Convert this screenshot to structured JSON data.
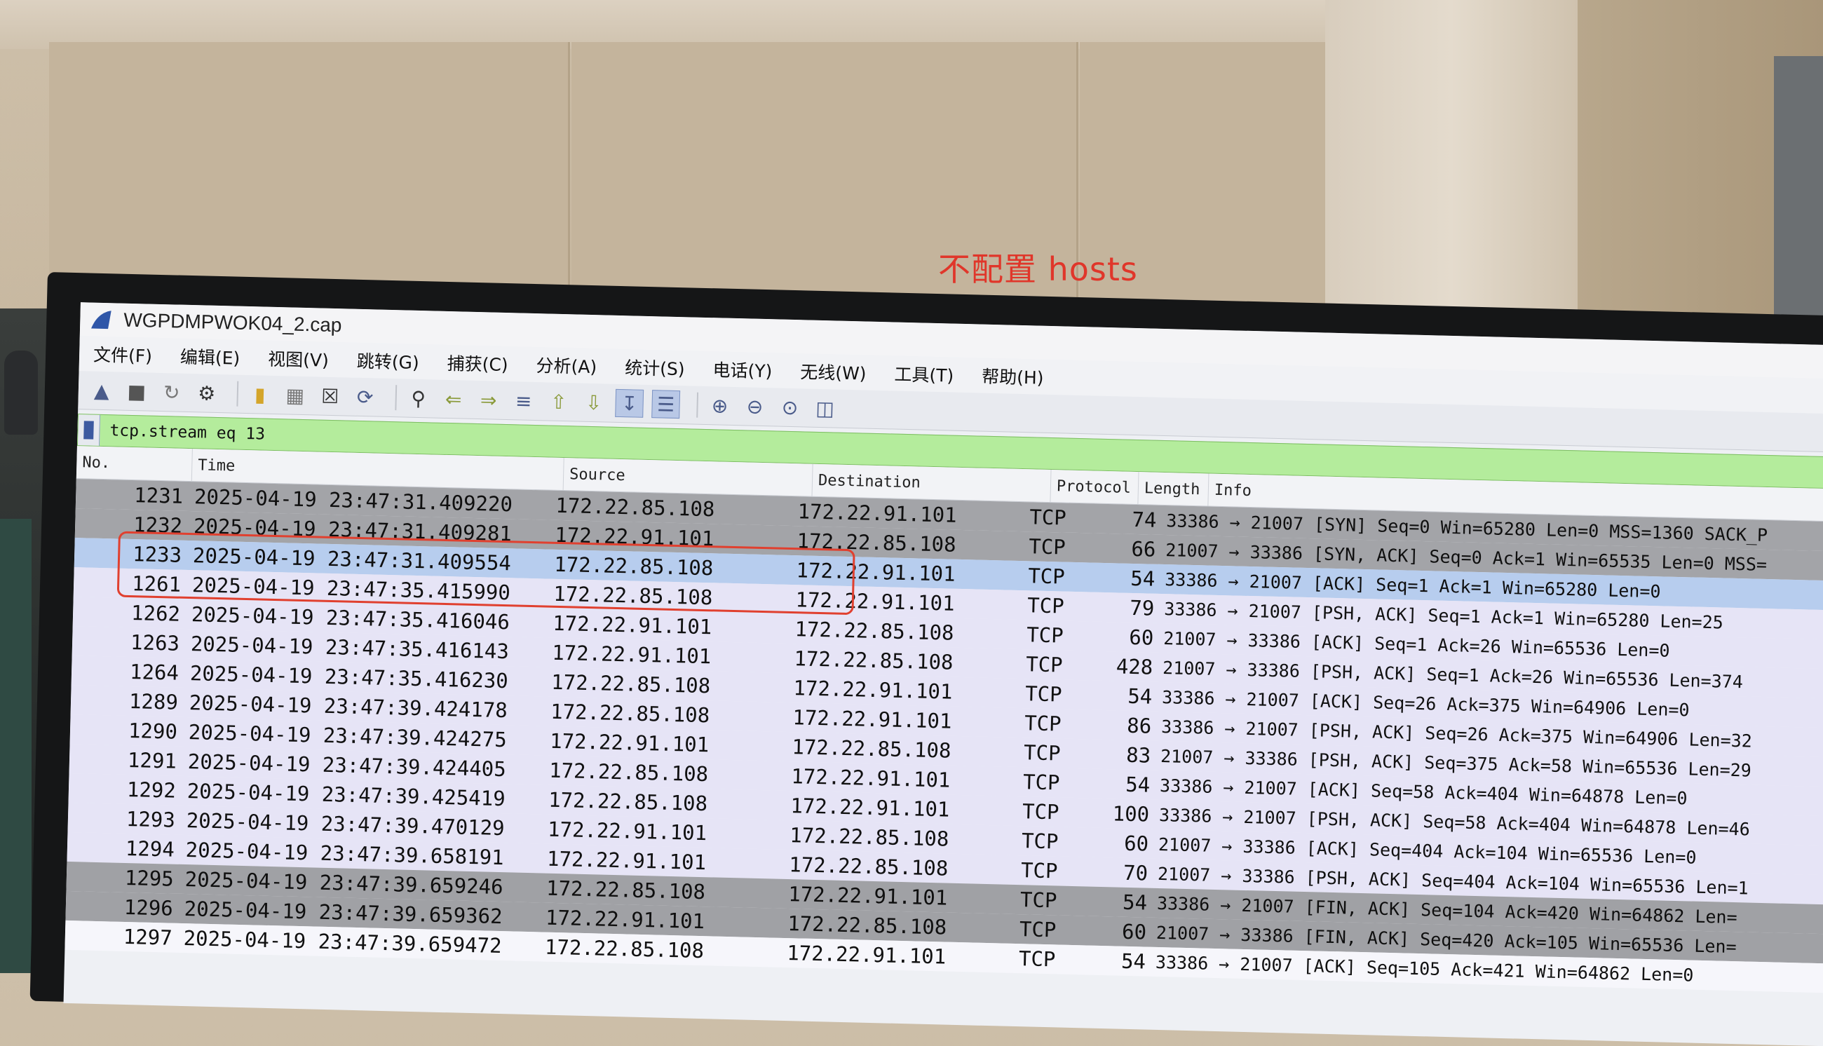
{
  "annotation_label": "不配置 hosts",
  "window": {
    "title": "WGPDMPWOK04_2.cap"
  },
  "menu": [
    "文件(F)",
    "编辑(E)",
    "视图(V)",
    "跳转(G)",
    "捕获(C)",
    "分析(A)",
    "统计(S)",
    "电话(Y)",
    "无线(W)",
    "工具(T)",
    "帮助(H)"
  ],
  "toolbar_icons": [
    "shark-fin-icon",
    "stop-icon",
    "restart-icon",
    "options-icon",
    "open-file-icon",
    "save-icon",
    "close-file-icon",
    "reload-icon",
    "find-icon",
    "back-arrow-icon",
    "forward-arrow-icon",
    "go-to-packet-icon",
    "first-packet-icon",
    "last-packet-icon",
    "autoscroll-icon",
    "colorize-icon",
    "zoom-in-icon",
    "zoom-out-icon",
    "normal-size-icon",
    "resize-columns-icon"
  ],
  "filter": {
    "value": "tcp.stream eq 13"
  },
  "columns": [
    "No.",
    "Time",
    "Source",
    "Destination",
    "Protocol",
    "Length",
    "Info"
  ],
  "packets": [
    {
      "no": "1231",
      "time": "2025-04-19 23:47:31.409220",
      "src": "172.22.85.108",
      "dst": "172.22.91.101",
      "proto": "TCP",
      "len": "74",
      "info": "33386 → 21007 [SYN] Seq=0 Win=65280 Len=0 MSS=1360 SACK_P",
      "style": "syn"
    },
    {
      "no": "1232",
      "time": "2025-04-19 23:47:31.409281",
      "src": "172.22.91.101",
      "dst": "172.22.85.108",
      "proto": "TCP",
      "len": "66",
      "info": "21007 → 33386 [SYN, ACK] Seq=0 Ack=1 Win=65535 Len=0 MSS=",
      "style": "syn"
    },
    {
      "no": "1233",
      "time": "2025-04-19 23:47:31.409554",
      "src": "172.22.85.108",
      "dst": "172.22.91.101",
      "proto": "TCP",
      "len": "54",
      "info": "33386 → 21007 [ACK] Seq=1 Ack=1 Win=65280 Len=0",
      "style": "sel"
    },
    {
      "no": "1261",
      "time": "2025-04-19 23:47:35.415990",
      "src": "172.22.85.108",
      "dst": "172.22.91.101",
      "proto": "TCP",
      "len": "79",
      "info": "33386 → 21007 [PSH, ACK] Seq=1 Ack=1 Win=65280 Len=25",
      "style": "norm"
    },
    {
      "no": "1262",
      "time": "2025-04-19 23:47:35.416046",
      "src": "172.22.91.101",
      "dst": "172.22.85.108",
      "proto": "TCP",
      "len": "60",
      "info": "21007 → 33386 [ACK] Seq=1 Ack=26 Win=65536 Len=0",
      "style": "norm"
    },
    {
      "no": "1263",
      "time": "2025-04-19 23:47:35.416143",
      "src": "172.22.91.101",
      "dst": "172.22.85.108",
      "proto": "TCP",
      "len": "428",
      "info": "21007 → 33386 [PSH, ACK] Seq=1 Ack=26 Win=65536 Len=374",
      "style": "norm"
    },
    {
      "no": "1264",
      "time": "2025-04-19 23:47:35.416230",
      "src": "172.22.85.108",
      "dst": "172.22.91.101",
      "proto": "TCP",
      "len": "54",
      "info": "33386 → 21007 [ACK] Seq=26 Ack=375 Win=64906 Len=0",
      "style": "norm"
    },
    {
      "no": "1289",
      "time": "2025-04-19 23:47:39.424178",
      "src": "172.22.85.108",
      "dst": "172.22.91.101",
      "proto": "TCP",
      "len": "86",
      "info": "33386 → 21007 [PSH, ACK] Seq=26 Ack=375 Win=64906 Len=32",
      "style": "norm"
    },
    {
      "no": "1290",
      "time": "2025-04-19 23:47:39.424275",
      "src": "172.22.91.101",
      "dst": "172.22.85.108",
      "proto": "TCP",
      "len": "83",
      "info": "21007 → 33386 [PSH, ACK] Seq=375 Ack=58 Win=65536 Len=29",
      "style": "norm"
    },
    {
      "no": "1291",
      "time": "2025-04-19 23:47:39.424405",
      "src": "172.22.85.108",
      "dst": "172.22.91.101",
      "proto": "TCP",
      "len": "54",
      "info": "33386 → 21007 [ACK] Seq=58 Ack=404 Win=64878 Len=0",
      "style": "norm"
    },
    {
      "no": "1292",
      "time": "2025-04-19 23:47:39.425419",
      "src": "172.22.85.108",
      "dst": "172.22.91.101",
      "proto": "TCP",
      "len": "100",
      "info": "33386 → 21007 [PSH, ACK] Seq=58 Ack=404 Win=64878 Len=46",
      "style": "norm"
    },
    {
      "no": "1293",
      "time": "2025-04-19 23:47:39.470129",
      "src": "172.22.91.101",
      "dst": "172.22.85.108",
      "proto": "TCP",
      "len": "60",
      "info": "21007 → 33386 [ACK] Seq=404 Ack=104 Win=65536 Len=0",
      "style": "norm"
    },
    {
      "no": "1294",
      "time": "2025-04-19 23:47:39.658191",
      "src": "172.22.91.101",
      "dst": "172.22.85.108",
      "proto": "TCP",
      "len": "70",
      "info": "21007 → 33386 [PSH, ACK] Seq=404 Ack=104 Win=65536 Len=1",
      "style": "norm"
    },
    {
      "no": "1295",
      "time": "2025-04-19 23:47:39.659246",
      "src": "172.22.85.108",
      "dst": "172.22.91.101",
      "proto": "TCP",
      "len": "54",
      "info": "33386 → 21007 [FIN, ACK] Seq=104 Ack=420 Win=64862 Len=",
      "style": "fin"
    },
    {
      "no": "1296",
      "time": "2025-04-19 23:47:39.659362",
      "src": "172.22.91.101",
      "dst": "172.22.85.108",
      "proto": "TCP",
      "len": "60",
      "info": "21007 → 33386 [FIN, ACK] Seq=420 Ack=105 Win=65536 Len=",
      "style": "fin"
    },
    {
      "no": "1297",
      "time": "2025-04-19 23:47:39.659472",
      "src": "172.22.85.108",
      "dst": "172.22.91.101",
      "proto": "TCP",
      "len": "54",
      "info": "33386 → 21007 [ACK] Seq=105 Ack=421 Win=64862 Len=0",
      "style": "white"
    }
  ],
  "colors": {
    "filter_bg": "#b4ec9c",
    "highlight_box": "#e0402f",
    "selected_row": "#b7cdee"
  }
}
